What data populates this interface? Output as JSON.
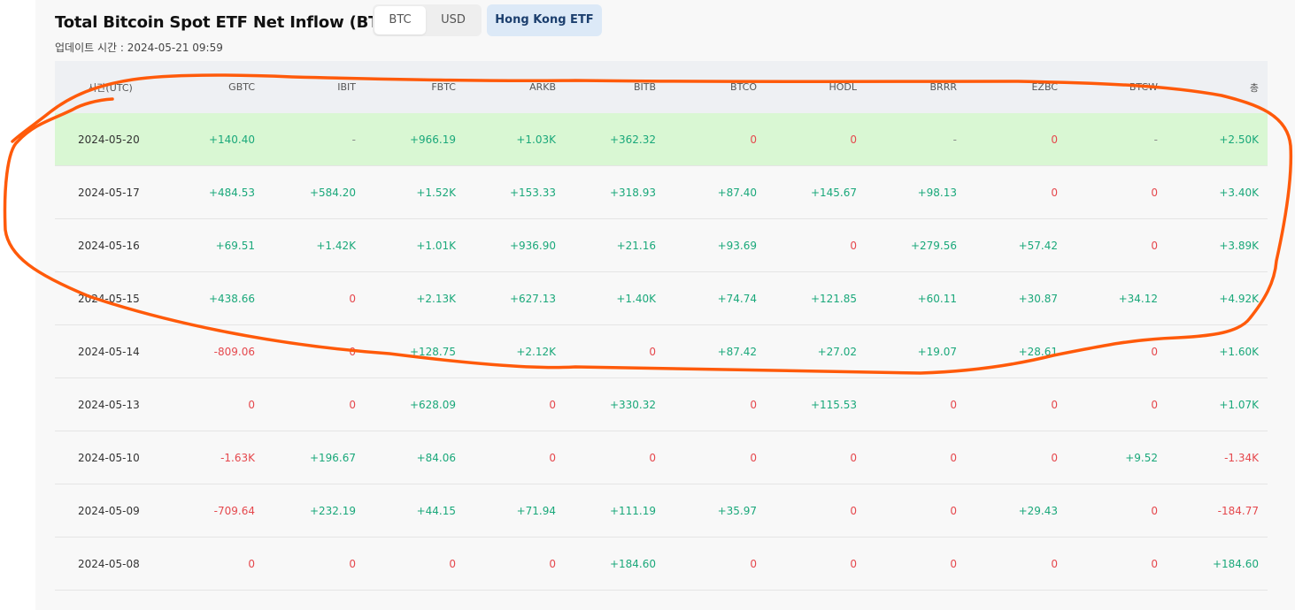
{
  "header": {
    "title": "Total Bitcoin Spot ETF Net Inflow (BTC)",
    "toggle_btc": "BTC",
    "toggle_usd": "USD",
    "hk_etf": "Hong Kong ETF",
    "updated": "업데이트 시간 : 2024-05-21 09:59"
  },
  "table": {
    "columns": [
      "시간(UTC)",
      "GBTC",
      "IBIT",
      "FBTC",
      "ARKB",
      "BITB",
      "BTCO",
      "HODL",
      "BRRR",
      "EZBC",
      "BTCW",
      "총"
    ],
    "rows": [
      [
        "2024-05-20",
        "+140.40",
        "-",
        "+966.19",
        "+1.03K",
        "+362.32",
        "0",
        "0",
        "-",
        "0",
        "-",
        "+2.50K"
      ],
      [
        "2024-05-17",
        "+484.53",
        "+584.20",
        "+1.52K",
        "+153.33",
        "+318.93",
        "+87.40",
        "+145.67",
        "+98.13",
        "0",
        "0",
        "+3.40K"
      ],
      [
        "2024-05-16",
        "+69.51",
        "+1.42K",
        "+1.01K",
        "+936.90",
        "+21.16",
        "+93.69",
        "0",
        "+279.56",
        "+57.42",
        "0",
        "+3.89K"
      ],
      [
        "2024-05-15",
        "+438.66",
        "0",
        "+2.13K",
        "+627.13",
        "+1.40K",
        "+74.74",
        "+121.85",
        "+60.11",
        "+30.87",
        "+34.12",
        "+4.92K"
      ],
      [
        "2024-05-14",
        "-809.06",
        "0",
        "+128.75",
        "+2.12K",
        "0",
        "+87.42",
        "+27.02",
        "+19.07",
        "+28.61",
        "0",
        "+1.60K"
      ],
      [
        "2024-05-13",
        "0",
        "0",
        "+628.09",
        "0",
        "+330.32",
        "0",
        "+115.53",
        "0",
        "0",
        "0",
        "+1.07K"
      ],
      [
        "2024-05-10",
        "-1.63K",
        "+196.67",
        "+84.06",
        "0",
        "0",
        "0",
        "0",
        "0",
        "0",
        "+9.52",
        "-1.34K"
      ],
      [
        "2024-05-09",
        "-709.64",
        "+232.19",
        "+44.15",
        "+71.94",
        "+111.19",
        "+35.97",
        "0",
        "0",
        "+29.43",
        "0",
        "-184.77"
      ],
      [
        "2024-05-08",
        "0",
        "0",
        "0",
        "0",
        "+184.60",
        "0",
        "0",
        "0",
        "0",
        "0",
        "+184.60"
      ]
    ],
    "highlighted_row": 0
  },
  "colors": {
    "positive": "#1aa87a",
    "negative": "#e5484d",
    "highlight": "#d9f7d3",
    "annotation": "#ff5a0a"
  }
}
